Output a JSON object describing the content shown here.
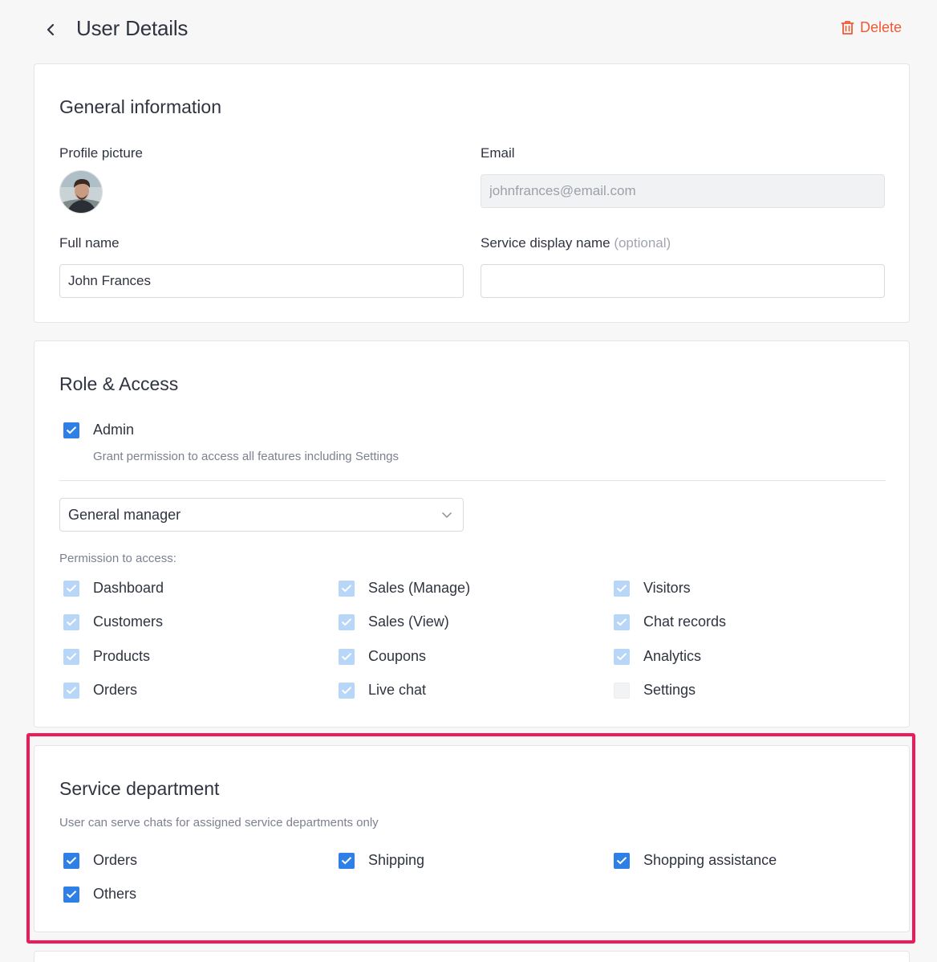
{
  "header": {
    "title": "User Details",
    "delete_label": "Delete"
  },
  "general": {
    "title": "General information",
    "profile_picture_label": "Profile picture",
    "email_label": "Email",
    "email_value": "johnfrances@email.com",
    "full_name_label": "Full name",
    "full_name_value": "John Frances",
    "display_name_label": "Service display name",
    "display_name_optional": "(optional)",
    "display_name_value": ""
  },
  "role": {
    "title": "Role & Access",
    "admin_label": "Admin",
    "admin_checked": true,
    "admin_helper": "Grant permission to access all features including Settings",
    "role_select_value": "General manager",
    "permission_label": "Permission to access:",
    "permissions": [
      {
        "label": "Dashboard",
        "checked": true
      },
      {
        "label": "Customers",
        "checked": true
      },
      {
        "label": "Products",
        "checked": true
      },
      {
        "label": "Orders",
        "checked": true
      },
      {
        "label": "Sales (Manage)",
        "checked": true
      },
      {
        "label": "Sales (View)",
        "checked": true
      },
      {
        "label": "Coupons",
        "checked": true
      },
      {
        "label": "Live chat",
        "checked": true
      },
      {
        "label": "Visitors",
        "checked": true
      },
      {
        "label": "Chat records",
        "checked": true
      },
      {
        "label": "Analytics",
        "checked": true
      },
      {
        "label": "Settings",
        "checked": false
      }
    ]
  },
  "service": {
    "title": "Service department",
    "helper": "User can serve chats for assigned service departments only",
    "departments": [
      {
        "label": "Orders",
        "checked": true
      },
      {
        "label": "Shipping",
        "checked": true
      },
      {
        "label": "Shopping assistance",
        "checked": true
      },
      {
        "label": "Others",
        "checked": true
      }
    ]
  },
  "colors": {
    "accent": "#2f80e6",
    "accent_soft": "#b8d6f7",
    "delete": "#ee5a33",
    "highlight": "#ef1a5a"
  }
}
